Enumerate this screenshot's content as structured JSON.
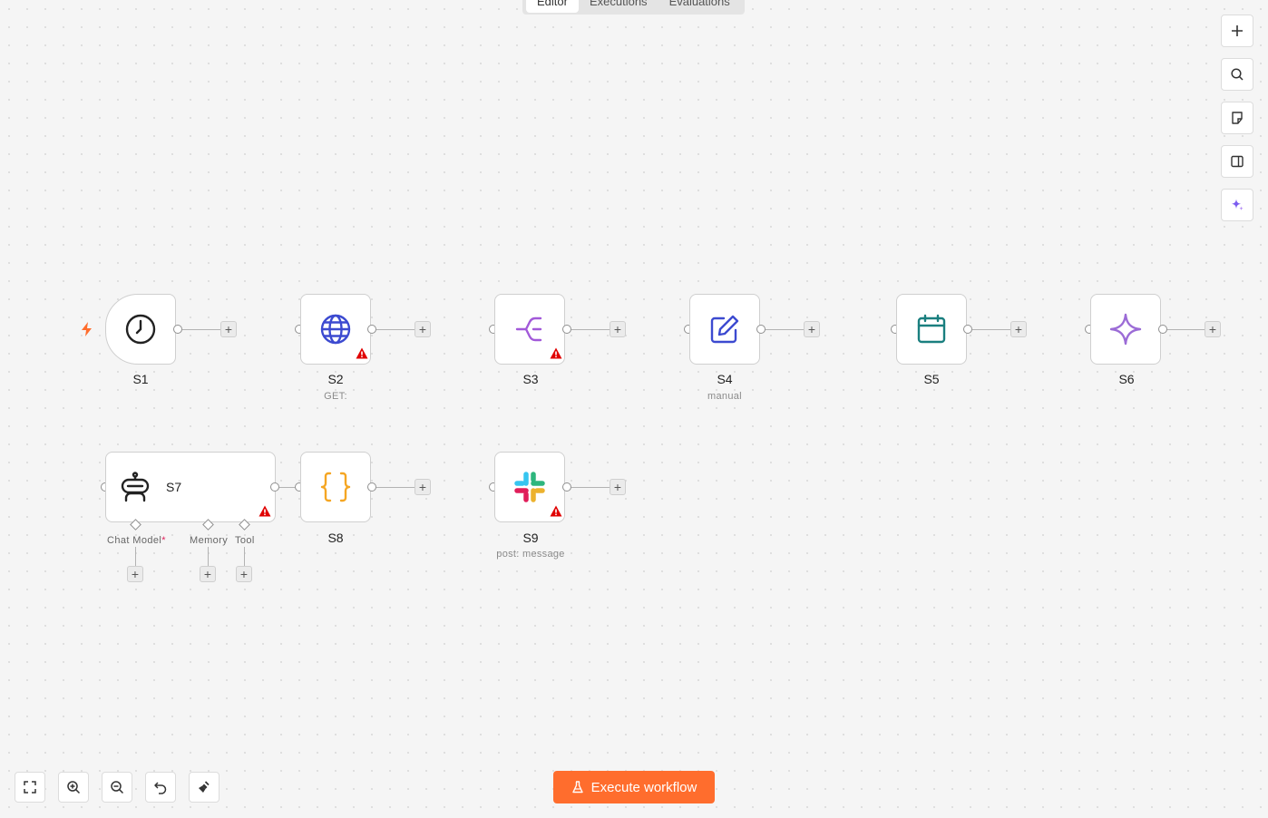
{
  "tabs": [
    {
      "label": "Editor",
      "active": true
    },
    {
      "label": "Executions",
      "active": false
    },
    {
      "label": "Evaluations",
      "active": false
    }
  ],
  "right_toolbar": [
    "plus-icon",
    "search-icon",
    "sticky-note-icon",
    "panel-toggle-icon",
    "ai-sparkle-icon"
  ],
  "nodes": [
    {
      "id": "s1",
      "label": "S1",
      "subtitle": "",
      "icon": "clock-icon",
      "trigger": true,
      "warning": false
    },
    {
      "id": "s2",
      "label": "S2",
      "subtitle": "GET:",
      "icon": "globe-icon",
      "warning": true
    },
    {
      "id": "s3",
      "label": "S3",
      "subtitle": "",
      "icon": "branch-icon",
      "warning": true
    },
    {
      "id": "s4",
      "label": "S4",
      "subtitle": "manual",
      "icon": "edit-icon",
      "warning": false
    },
    {
      "id": "s5",
      "label": "S5",
      "subtitle": "",
      "icon": "calendar-icon",
      "warning": false
    },
    {
      "id": "s6",
      "label": "S6",
      "subtitle": "",
      "icon": "sparkle-icon",
      "warning": false
    },
    {
      "id": "s7",
      "label": "S7",
      "subtitle": "",
      "icon": "robot-icon",
      "warning": true
    },
    {
      "id": "s8",
      "label": "S8",
      "subtitle": "",
      "icon": "braces-icon",
      "warning": false
    },
    {
      "id": "s9",
      "label": "S9",
      "subtitle": "post: message",
      "icon": "slack-icon",
      "warning": true
    }
  ],
  "agent_inputs": {
    "chat_model": "Chat Model",
    "chat_model_required": "*",
    "memory": "Memory",
    "tool": "Tool"
  },
  "plus_symbol": "+",
  "execute_button": "Execute workflow",
  "colors": {
    "accent": "#ff6d2d",
    "warning": "#e00000",
    "globe": "#3c4ad0",
    "branch": "#a259d9",
    "edit": "#3c4ad0",
    "calendar": "#1a7f7f",
    "sparkle": "#9b6bd6",
    "braces": "#f5a623"
  }
}
